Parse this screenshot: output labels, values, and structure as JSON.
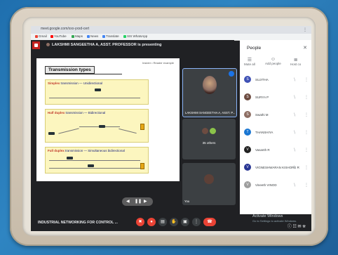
{
  "browser": {
    "url": "meet.google.com/xxx-yxxd-cert",
    "bookmarks": [
      {
        "label": "Gmail",
        "color": "#ea4335"
      },
      {
        "label": "YouTube",
        "color": "#ff0000"
      },
      {
        "label": "Maps",
        "color": "#34a853"
      },
      {
        "label": "News",
        "color": "#4285f4"
      },
      {
        "label": "Translate",
        "color": "#4285f4"
      },
      {
        "label": "SIS WhatsApp",
        "color": "#25d366"
      }
    ]
  },
  "header": {
    "presenting_text": "LAKSHMI SANGEETHA A, ASST. PROFESSOR is presenting"
  },
  "slide": {
    "corner_text": "Insider  •  Reader example",
    "title": "Transmission types",
    "simplex": {
      "term": "Simplex",
      "desc": "transmission — Unidirectional"
    },
    "half_duplex": {
      "term": "Half duplex",
      "desc": "transmission — Bidirectional"
    },
    "full_duplex": {
      "term": "Full duplex",
      "desc": "transmission — Simultaneous bidirectional"
    },
    "nav": {
      "prev": "◀",
      "pause": "❚❚",
      "next": "▶"
    }
  },
  "tiles": {
    "presenter_label": "LAKSHMI SANGEETHA A, ASST. P...",
    "others_label": "35 others",
    "you_label": "You"
  },
  "bottom": {
    "meeting_name": "INDUSTRIAL NETWORKING FOR CONTROL ...",
    "controls": {
      "mic": "✖",
      "cam": "●",
      "captions": "▤",
      "hand": "✋",
      "present": "▣",
      "more": "⋮",
      "end": "☎"
    },
    "activate_title": "Activate Windows",
    "activate_sub": "Go to Settings to activate Windows.",
    "right_icons": "ⓘ   ☷   ✉   ⛯"
  },
  "people": {
    "title": "People",
    "close": "✕",
    "actions": [
      {
        "icon": "☰",
        "label": "Mute all"
      },
      {
        "icon": "☺",
        "label": "Add people"
      },
      {
        "icon": "≣",
        "label": "Host co"
      }
    ],
    "participants": [
      {
        "name": "SUJITHA",
        "initial": "S",
        "color": "#3f51b5",
        "mic": "∖",
        "more": "⋮"
      },
      {
        "name": "SURYA P",
        "initial": "S",
        "color": "#6d4c41",
        "mic": "∖",
        "more": "⋮"
      },
      {
        "name": "Swathi M",
        "initial": "S",
        "color": "#8d6e63",
        "mic": "∖",
        "more": "⋮"
      },
      {
        "name": "THANSHIYA",
        "initial": "T",
        "color": "#1976d2",
        "mic": "∖",
        "more": "⋮"
      },
      {
        "name": "Vasanth R",
        "initial": "V",
        "color": "#212121",
        "mic": "∖",
        "more": "⋮"
      },
      {
        "name": "VIGNESHWARAN KISHORE R",
        "initial": "V",
        "color": "#283593",
        "mic": "∖",
        "more": "⋮"
      },
      {
        "name": "Vineeth VINOD",
        "initial": "V",
        "color": "#9e9e9e",
        "mic": "∖",
        "more": "⋮"
      }
    ]
  }
}
